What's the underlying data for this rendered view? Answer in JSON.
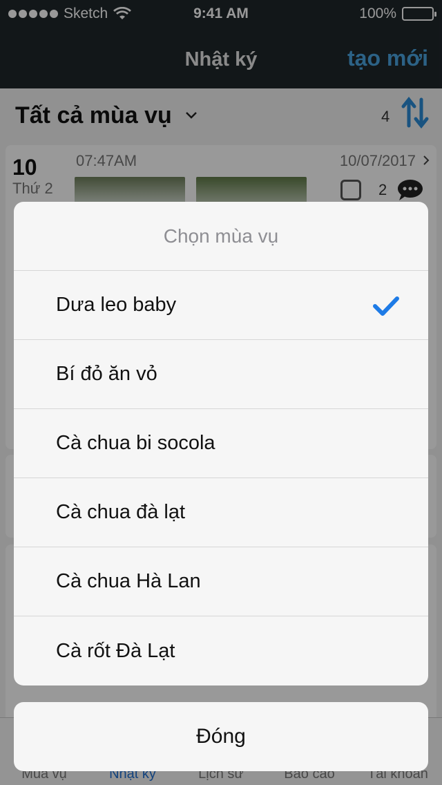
{
  "status_bar": {
    "carrier": "Sketch",
    "time": "9:41 AM",
    "battery": "100%"
  },
  "nav": {
    "title": "Nhật ký",
    "action": "tạo mới"
  },
  "filter": {
    "title": "Tất cả mùa vụ",
    "count": "4"
  },
  "entry": {
    "day": "10",
    "weekday": "Thứ 2",
    "time": "07:47AM",
    "date": "10/07/2017",
    "comments": "2"
  },
  "sheet": {
    "title": "Chọn mùa vụ",
    "options": [
      {
        "label": "Dưa leo baby",
        "selected": true
      },
      {
        "label": "Bí đỏ ăn vỏ",
        "selected": false
      },
      {
        "label": "Cà chua bi socola",
        "selected": false
      },
      {
        "label": "Cà chua đà lạt",
        "selected": false
      },
      {
        "label": "Cà chua Hà Lan",
        "selected": false
      },
      {
        "label": "Cà rốt Đà Lạt",
        "selected": false
      }
    ],
    "cancel": "Đóng"
  },
  "tabs": [
    {
      "label": "Mùa vụ",
      "active": false
    },
    {
      "label": "Nhật ký",
      "active": true
    },
    {
      "label": "Lịch sử",
      "active": false
    },
    {
      "label": "Báo cáo",
      "active": false
    },
    {
      "label": "Tài khoản",
      "active": false
    }
  ],
  "colors": {
    "accent": "#4aa3df",
    "checkmark": "#1e7be6",
    "nav_bg": "#1f272b"
  }
}
